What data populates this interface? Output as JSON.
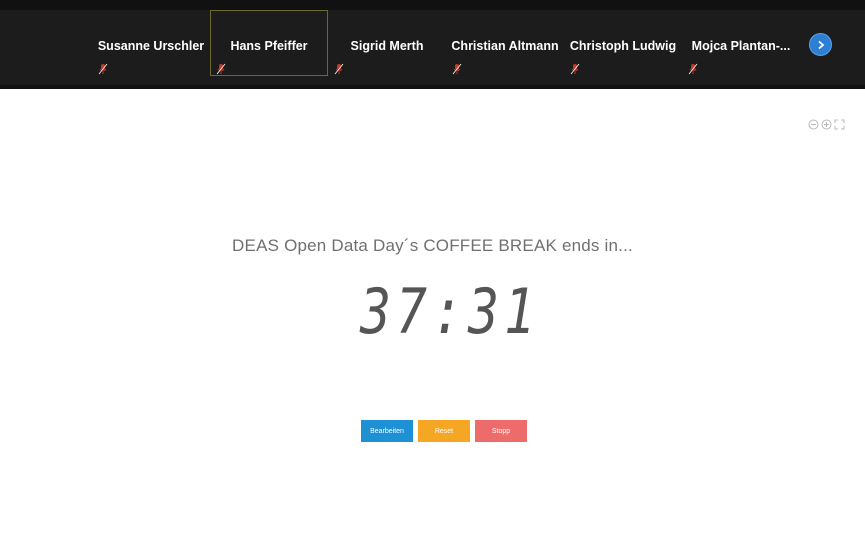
{
  "participants": [
    {
      "name": "Susanne Urschler",
      "active": false
    },
    {
      "name": "Hans Pfeiffer",
      "active": true
    },
    {
      "name": "Sigrid Merth",
      "active": false
    },
    {
      "name": "Christian Altmann",
      "active": false
    },
    {
      "name": "Christoph Ludwig",
      "active": false
    },
    {
      "name": "Mojca Plantan-...",
      "active": false
    }
  ],
  "icons": {
    "mic_muted": "mic-muted-icon",
    "next": "chevron-right-icon",
    "zoom_out": "zoom-out-icon",
    "zoom_in": "zoom-in-icon",
    "fullscreen": "fullscreen-icon"
  },
  "countdown": {
    "title": "DEAS Open Data Day´s COFFEE BREAK ends in...",
    "time": "37:31"
  },
  "buttons": {
    "edit": {
      "label": "Bearbeiten",
      "color": "#1e90d6"
    },
    "reset": {
      "label": "Reset",
      "color": "#f5a623"
    },
    "stop": {
      "label": "Stopp",
      "color": "#ee6b6b"
    }
  },
  "colors": {
    "topbar": "#1c1c1c",
    "mic_muted": "#c0392b",
    "timer_digits": "#555555",
    "next_button": "#2d7fd3"
  }
}
